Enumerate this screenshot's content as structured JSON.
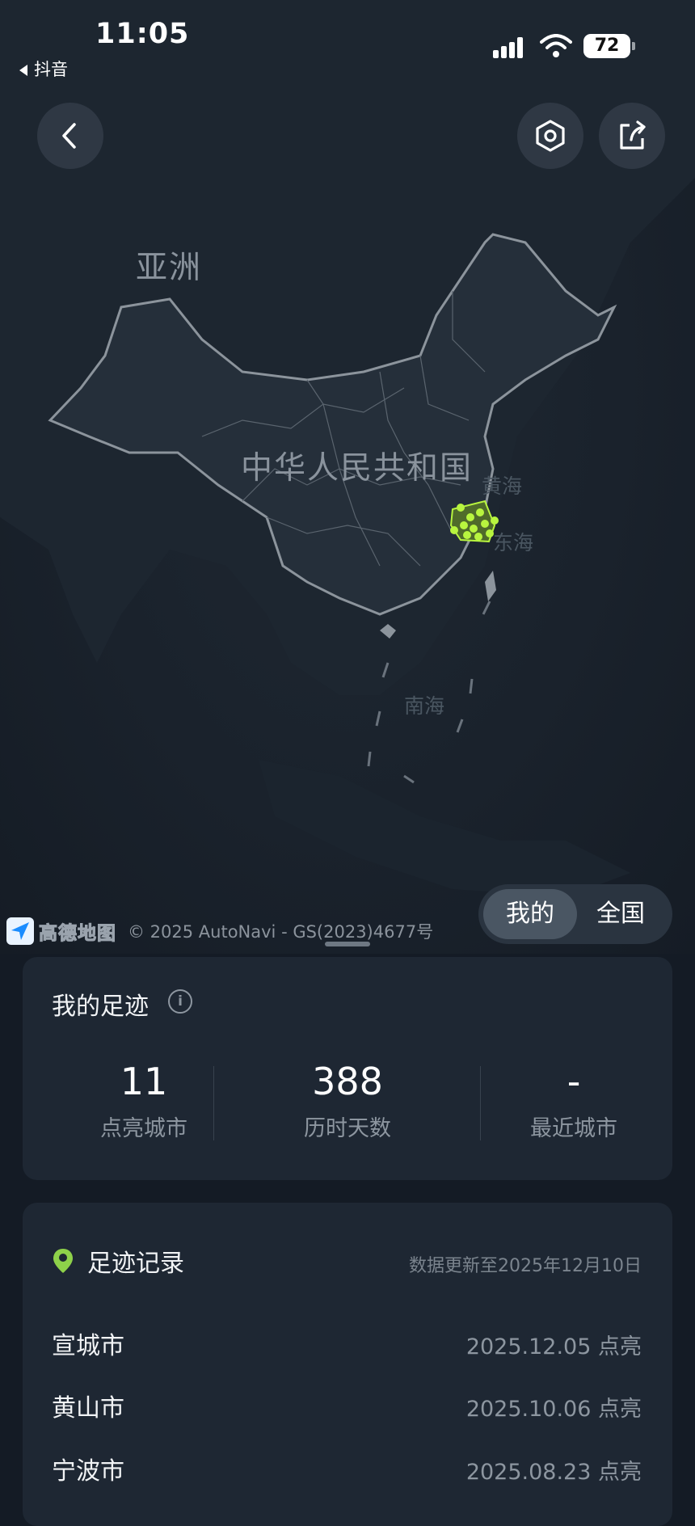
{
  "status_bar": {
    "time": "11:05",
    "back_app": "抖音",
    "battery": "72"
  },
  "map": {
    "labels": {
      "continent": "亚洲",
      "country": "中华人民共和国",
      "sea_yellow": "黄海",
      "sea_east": "东海",
      "sea_south": "南海"
    },
    "attribution": {
      "logo_text": "高德地图",
      "copyright": "© 2025 AutoNavi - GS(2023)4677号"
    },
    "toggle": [
      "我的",
      "全国"
    ],
    "toggle_selected": "我的",
    "colors": {
      "highlight": "#b8f53f",
      "border": "#8c949c"
    }
  },
  "summary": {
    "title": "我的足迹",
    "stats": [
      {
        "value": "11",
        "label": "点亮城市"
      },
      {
        "value": "388",
        "label": "历时天数"
      },
      {
        "value": "-",
        "label": "最近城市"
      }
    ]
  },
  "records": {
    "title": "足迹记录",
    "updated": "数据更新至2025年12月10日",
    "items": [
      {
        "city": "宣城市",
        "date": "2025.12.05 点亮"
      },
      {
        "city": "黄山市",
        "date": "2025.10.06 点亮"
      },
      {
        "city": "宁波市",
        "date": "2025.08.23 点亮"
      }
    ]
  }
}
